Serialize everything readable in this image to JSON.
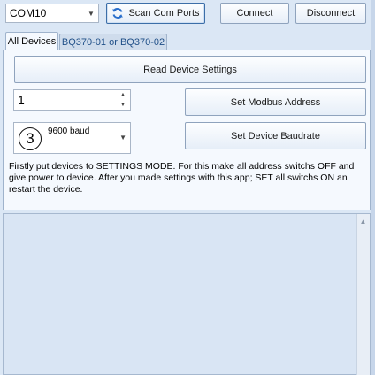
{
  "toolbar": {
    "port_value": "COM10",
    "scan_label": "Scan Com Ports",
    "connect_label": "Connect",
    "disconnect_label": "Disconnect"
  },
  "tabs": [
    {
      "label": "All Devices",
      "active": true
    },
    {
      "label": "BQ370-01 or BQ370-02",
      "active": false
    }
  ],
  "panel": {
    "read_label": "Read Device Settings",
    "address_value": "1",
    "set_address_label": "Set Modbus Address",
    "annotation_number": "3",
    "baud_value": "9600 baud",
    "set_baud_label": "Set Device Baudrate",
    "note": "Firstly put devices to SETTINGS MODE. For this make all address switchs OFF and give power to device.  After you made settings with this app; SET all switchs ON an restart the device."
  },
  "icons": {
    "scan": "refresh-arrows-icon",
    "dropdown": "chevron-down-icon"
  },
  "colors": {
    "background": "#dbe7f5",
    "panel": "#f5f9fe",
    "scan_icon": "#2a6fcc"
  }
}
